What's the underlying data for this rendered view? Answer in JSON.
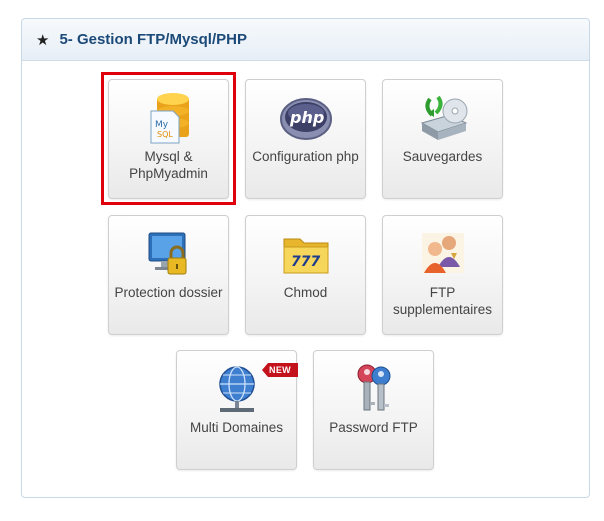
{
  "section": {
    "star": "★",
    "title": "5- Gestion FTP/Mysql/PHP"
  },
  "tiles": [
    {
      "id": "mysql",
      "line1": "Mysql &",
      "line2": "PhpMyadmin"
    },
    {
      "id": "phpconf",
      "line1": "Configuration php"
    },
    {
      "id": "backup",
      "line1": "Sauvegardes"
    },
    {
      "id": "protect",
      "line1": "Protection dossier"
    },
    {
      "id": "chmod",
      "line1": "Chmod"
    },
    {
      "id": "ftp",
      "line1": "FTP",
      "line2": "supplementaires"
    },
    {
      "id": "domains",
      "line1": "Multi Domaines",
      "badge": "NEW"
    },
    {
      "id": "pwdftp",
      "line1": "Password FTP"
    }
  ],
  "icons": {
    "mysql": "mysql-database-icon",
    "phpconf": "php-config-icon",
    "backup": "backup-disk-icon",
    "protect": "locked-monitor-icon",
    "chmod": "chmod-folder-icon",
    "ftp": "ftp-users-icon",
    "domains": "globe-network-icon",
    "pwdftp": "keys-icon"
  },
  "colors": {
    "title": "#1c4a78",
    "highlight": "#e0000b",
    "badge": "#c4121d"
  }
}
